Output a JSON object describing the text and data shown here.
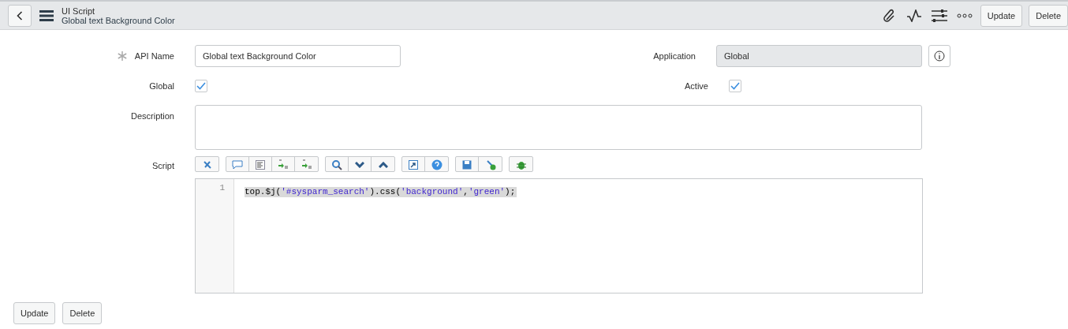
{
  "header": {
    "title": "UI Script",
    "subtitle": "Global text Background Color",
    "buttons": [
      "Update",
      "Delete"
    ]
  },
  "form": {
    "api_name": {
      "label": "API Name",
      "required": true,
      "value": "Global text Background Color"
    },
    "application": {
      "label": "Application",
      "value": "Global",
      "disabled": true
    },
    "global": {
      "label": "Global",
      "checked": true
    },
    "active": {
      "label": "Active",
      "checked": true
    },
    "description": {
      "label": "Description"
    },
    "script": {
      "label": "Script",
      "lines": [
        {
          "number": "1",
          "tokens": [
            {
              "kind": "plain",
              "text": "top.$j("
            },
            {
              "kind": "string",
              "text": "'#sysparm_search'"
            },
            {
              "kind": "plain",
              "text": ").css("
            },
            {
              "kind": "string",
              "text": "'background'"
            },
            {
              "kind": "plain",
              "text": ","
            },
            {
              "kind": "string",
              "text": "'green'"
            },
            {
              "kind": "plain",
              "text": ");"
            }
          ]
        }
      ]
    }
  },
  "footer_buttons": [
    "Update",
    "Delete"
  ]
}
